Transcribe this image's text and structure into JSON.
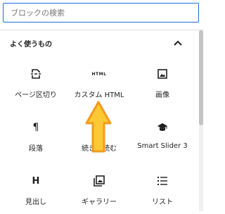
{
  "search": {
    "placeholder": "ブロックの検索"
  },
  "panel": {
    "title": "よく使うもの"
  },
  "blocks": [
    {
      "label": "ページ区切り",
      "icon": "page-break-icon"
    },
    {
      "label": "カスタム HTML",
      "icon": "html-icon",
      "icon_text": "HTML"
    },
    {
      "label": "画像",
      "icon": "image-icon"
    },
    {
      "label": "段落",
      "icon": "paragraph-icon",
      "icon_text": "¶"
    },
    {
      "label": "続きを読む",
      "icon": "more-icon"
    },
    {
      "label": "Smart Slider 3",
      "icon": "graduation-cap-icon"
    },
    {
      "label": "見出し",
      "icon": "heading-icon",
      "icon_text": "H"
    },
    {
      "label": "ギャラリー",
      "icon": "gallery-icon"
    },
    {
      "label": "リスト",
      "icon": "list-icon"
    }
  ],
  "colors": {
    "accent": "#1e6fd9",
    "arrow_fill": "#fcc833",
    "arrow_stroke": "#f39a1e"
  }
}
